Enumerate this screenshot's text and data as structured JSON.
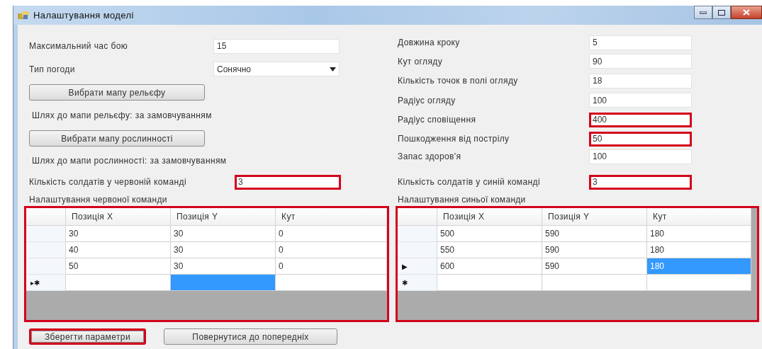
{
  "window": {
    "title": "Налаштування моделі"
  },
  "left_fields": [
    {
      "kind": "text",
      "label": "Максимальний час бою",
      "value": "15",
      "highlighted": false
    },
    {
      "kind": "dropdown",
      "label": "Тип погоди",
      "value": "Сонячно",
      "highlighted": false
    }
  ],
  "terrain": {
    "button": "Вибрати мапу рельєфу",
    "path": "Шлях до мапи рельєфу: за замовчуванням"
  },
  "vegetation": {
    "button": "Вибрати мапу рослинності",
    "path": "Шлях до мапи рослинності: за замовчуванням"
  },
  "right_fields": [
    {
      "label": "Довжина кроку",
      "value": "5",
      "highlighted": false
    },
    {
      "label": "Кут огляду",
      "value": "90",
      "highlighted": false
    },
    {
      "label": "Кількість точок в полі огляду",
      "value": "18",
      "highlighted": false
    },
    {
      "label": "Радіус огляду",
      "value": "100",
      "highlighted": false
    },
    {
      "label": "Радіус сповіщення",
      "value": "400",
      "highlighted": true
    },
    {
      "label": "Пошкодження від пострілу",
      "value": "50",
      "highlighted": true
    },
    {
      "label": "Запас здоров'я",
      "value": "100",
      "highlighted": false
    }
  ],
  "red_team": {
    "count_label": "Кількість солдатів у червоній команді",
    "count": "3",
    "count_highlighted": true,
    "title": "Налаштування червоної команди",
    "grid": {
      "highlighted": true,
      "columns": [
        "Позиція X",
        "Позиція Y",
        "Кут"
      ],
      "rows": [
        {
          "cells": [
            {
              "text": "30",
              "selected": false
            },
            {
              "text": "30",
              "selected": false
            },
            {
              "text": "0",
              "selected": false
            }
          ]
        },
        {
          "cells": [
            {
              "text": "40",
              "selected": false
            },
            {
              "text": "30",
              "selected": false
            },
            {
              "text": "0",
              "selected": false
            }
          ]
        },
        {
          "cells": [
            {
              "text": "50",
              "selected": false
            },
            {
              "text": "30",
              "selected": false
            },
            {
              "text": "0",
              "selected": false
            }
          ]
        },
        {
          "marker": "▸✱",
          "cells": [
            {
              "selected": false
            },
            {
              "selected": true
            },
            {
              "selected": false
            }
          ]
        }
      ]
    }
  },
  "blue_team": {
    "count_label": "Кількість солдатів у синій команді",
    "count": "3",
    "count_highlighted": true,
    "title": "Налаштування синьої команди",
    "grid": {
      "highlighted": true,
      "columns": [
        "Позиція X",
        "Позиція Y",
        "Кут"
      ],
      "rows": [
        {
          "cells": [
            {
              "text": "500",
              "selected": false
            },
            {
              "text": "590",
              "selected": false
            },
            {
              "text": "180",
              "selected": false
            }
          ]
        },
        {
          "cells": [
            {
              "text": "550",
              "selected": false
            },
            {
              "text": "590",
              "selected": false
            },
            {
              "text": "180",
              "selected": false
            }
          ]
        },
        {
          "marker": "▶",
          "cells": [
            {
              "text": "600",
              "selected": false
            },
            {
              "text": "590",
              "selected": false
            },
            {
              "text": "180",
              "selected": true
            }
          ]
        },
        {
          "marker": "✱",
          "cells": [
            {
              "selected": false
            },
            {
              "selected": false
            },
            {
              "selected": false
            }
          ]
        }
      ]
    }
  },
  "buttons": [
    {
      "label": "Зберегти параметри",
      "highlighted": true
    },
    {
      "label": "Повернутися до попередніх",
      "highlighted": false
    }
  ]
}
